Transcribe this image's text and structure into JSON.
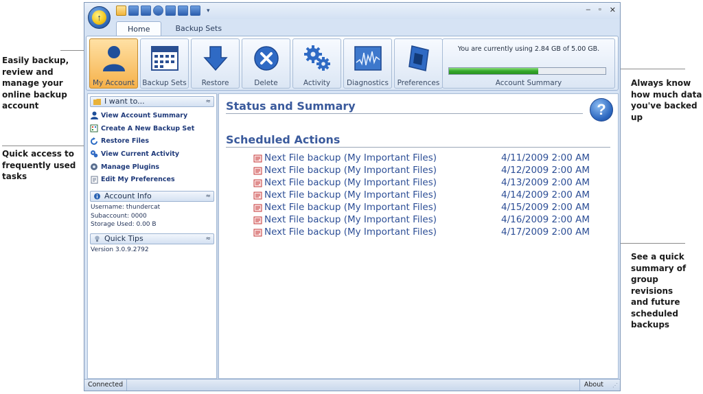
{
  "callouts": {
    "backup": [
      "Easily backup,",
      "review and",
      "manage your",
      "online backup",
      "account"
    ],
    "quick": [
      "Quick access to",
      "frequently used",
      "tasks"
    ],
    "know": [
      "Always know",
      "how much data",
      "you've backed up"
    ],
    "summary": [
      "See a quick",
      "summary of",
      "group revisions",
      "and future",
      "scheduled",
      "backups"
    ]
  },
  "window": {
    "qat_icons": [
      "my-account-icon",
      "backup-sets-icon",
      "restore-icon",
      "delete-icon",
      "activity-icon",
      "diagnostics-icon",
      "preferences-icon"
    ],
    "qat_dropdown": "▾",
    "controls": [
      "–",
      "▫",
      "✕"
    ]
  },
  "tabs": [
    "Home",
    "Backup Sets"
  ],
  "ribbon": {
    "buttons": [
      {
        "label": "My Account",
        "icon": "user-icon"
      },
      {
        "label": "Backup Sets",
        "icon": "calendar-icon"
      },
      {
        "label": "Restore",
        "icon": "down-arrow-icon"
      },
      {
        "label": "Delete",
        "icon": "x-circle-icon"
      },
      {
        "label": "Activity",
        "icon": "gears-icon"
      },
      {
        "label": "Diagnostics",
        "icon": "waveform-icon"
      },
      {
        "label": "Preferences",
        "icon": "preferences-icon"
      }
    ],
    "usage_text": "You are currently using 2.84 GB of 5.00 GB.",
    "usage_fraction": 0.568,
    "account_summary_label": "Account Summary"
  },
  "left_panel": {
    "i_want_to": {
      "title": "I want to...",
      "collapse": "≈",
      "tasks": [
        {
          "label": "View Account Summary",
          "icon": "user-icon"
        },
        {
          "label": "Create A New Backup Set",
          "icon": "new-backup-set-icon"
        },
        {
          "label": "Restore Files",
          "icon": "restore-icon"
        },
        {
          "label": "View Current Activity",
          "icon": "activity-icon"
        },
        {
          "label": "Manage Plugins",
          "icon": "plugins-icon"
        },
        {
          "label": "Edit My Preferences",
          "icon": "preferences-icon"
        }
      ]
    },
    "account_info": {
      "title": "Account Info",
      "collapse": "≈",
      "username": "Username: thundercat",
      "subaccount": "Subaccount: 0000",
      "storage": "Storage Used: 0.00 B"
    },
    "quick_tips": {
      "title": "Quick Tips",
      "collapse": "≈",
      "version": "Version 3.0.9.2792"
    }
  },
  "main": {
    "status_title": "Status and Summary",
    "scheduled_title": "Scheduled Actions",
    "help": "?",
    "scheduled": [
      {
        "name": "Next File backup (My Important Files)",
        "date": "4/11/2009 2:00 AM"
      },
      {
        "name": "Next File backup (My Important Files)",
        "date": "4/12/2009 2:00 AM"
      },
      {
        "name": "Next File backup (My Important Files)",
        "date": "4/13/2009 2:00 AM"
      },
      {
        "name": "Next File backup (My Important Files)",
        "date": "4/14/2009 2:00 AM"
      },
      {
        "name": "Next File backup (My Important Files)",
        "date": "4/15/2009 2:00 AM"
      },
      {
        "name": "Next File backup (My Important Files)",
        "date": "4/16/2009 2:00 AM"
      },
      {
        "name": "Next File backup (My Important Files)",
        "date": "4/17/2009 2:00 AM"
      }
    ]
  },
  "statusbar": {
    "left": "Connected",
    "right": "About"
  }
}
